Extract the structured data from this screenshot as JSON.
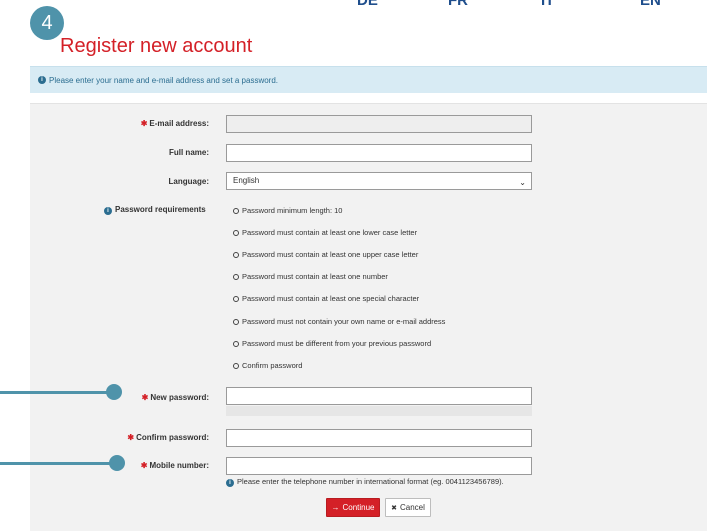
{
  "top_nav": {
    "items": [
      "DE",
      "FR",
      "IT",
      "EN"
    ]
  },
  "step": {
    "number": "4"
  },
  "title": "Register new account",
  "info": {
    "icon": "info-icon",
    "text": "Please enter your name and e-mail address and set a password."
  },
  "form": {
    "email_label": "E-mail address:",
    "email_value": "",
    "fullname_label": "Full name:",
    "fullname_value": "",
    "language_label": "Language:",
    "language_value": "English",
    "password_requirements_label": "Password requirements",
    "requirements": [
      "Password minimum length: 10",
      "Password must contain at least one lower case letter",
      "Password must contain at least one upper case letter",
      "Password must contain at least one number",
      "Password must contain at least one special character",
      "Password must not contain your own name or e-mail address",
      "Password must be different from your previous password",
      "Confirm password"
    ],
    "new_password_label": "New password:",
    "confirm_password_label": "Confirm password:",
    "mobile_label": "Mobile number:",
    "mobile_hint": "Please enter the telephone number in international format (eg. 0041123456789).",
    "required_marker": "✱"
  },
  "buttons": {
    "continue": "Continue",
    "cancel": "Cancel",
    "continue_icon": "→",
    "cancel_icon": "✖"
  },
  "colors": {
    "accent": "#d42027",
    "callout": "#4f93aa",
    "info_bg": "#d8ebf4"
  }
}
